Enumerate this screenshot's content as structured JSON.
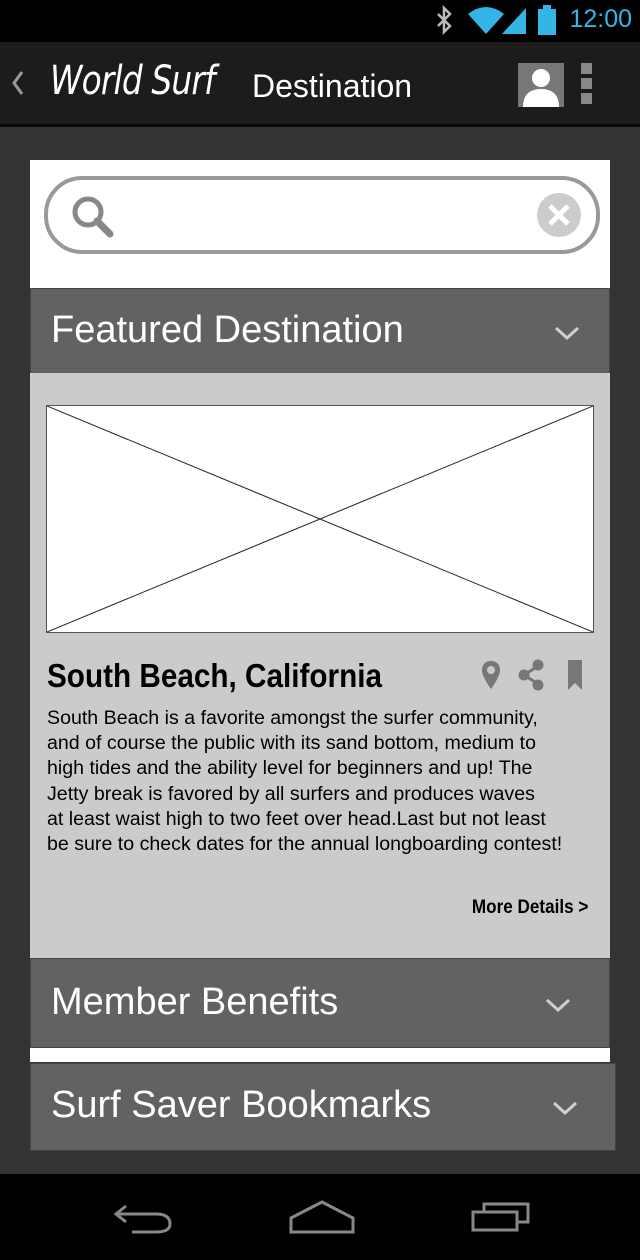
{
  "status_bar": {
    "time": "12:00",
    "colors": {
      "accent": "#33b5e5"
    }
  },
  "app_bar": {
    "app_title": "World Surf",
    "page_title": "Destination"
  },
  "search": {
    "placeholder": ""
  },
  "featured": {
    "header": "Featured Destination",
    "place_name": "South Beach, California",
    "description_lines": [
      "South Beach is a favorite amongst the surfer community,",
      "and of course the public with its sand bottom, medium to",
      "high tides and the ability level for beginners and up! The",
      "Jetty break is favored by all surfers and produces waves",
      "at least waist high to two feet over head.Last but not least",
      "be sure to check dates for the annual longboarding contest!"
    ],
    "more_details": "More Details >"
  },
  "sections": [
    {
      "label": "Member Benefits"
    },
    {
      "label": "Surf Saver Bookmarks"
    }
  ],
  "icons": [
    "back-icon",
    "avatar",
    "overflow-icon",
    "search-icon",
    "clear-icon",
    "chevron-down-icon",
    "location-pin-icon",
    "share-icon",
    "bookmark-icon",
    "nav-back-icon",
    "nav-home-icon",
    "nav-recents-icon",
    "bluetooth-icon",
    "wifi-icon",
    "signal-icon",
    "battery-icon"
  ]
}
